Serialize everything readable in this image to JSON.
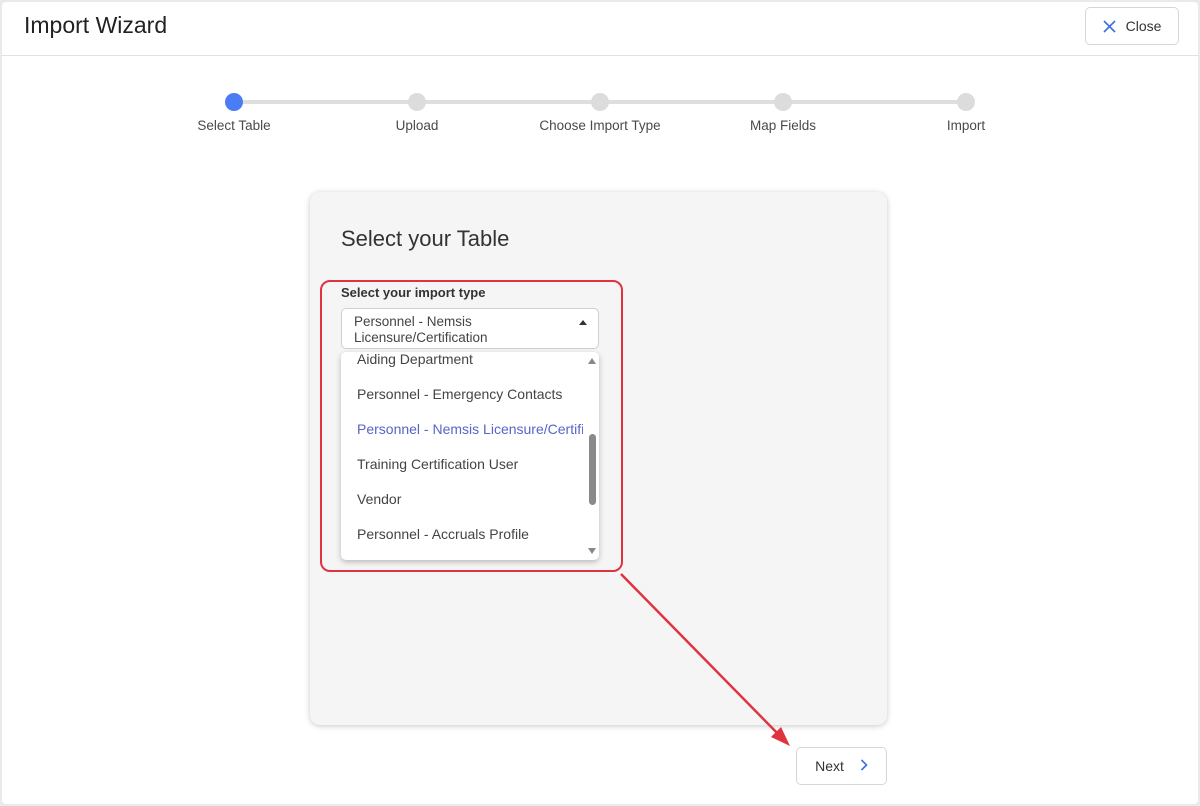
{
  "header": {
    "title": "Import Wizard",
    "close_label": "Close"
  },
  "stepper": {
    "steps": [
      {
        "label": "Select Table",
        "state": "active"
      },
      {
        "label": "Upload",
        "state": "pending"
      },
      {
        "label": "Choose Import Type",
        "state": "pending"
      },
      {
        "label": "Map Fields",
        "state": "pending"
      },
      {
        "label": "Import",
        "state": "pending"
      }
    ]
  },
  "card": {
    "title": "Select your Table",
    "select_label": "Select your import type",
    "selected_value": "Personnel - Nemsis Licensure/Certification",
    "options": [
      "Aiding Department",
      "Personnel - Emergency Contacts",
      "Personnel - Nemsis Licensure/Certification",
      "Training Certification User",
      "Vendor",
      "Personnel - Accruals Profile"
    ],
    "selected_index": 2
  },
  "footer": {
    "next_label": "Next"
  },
  "colors": {
    "accent": "#4a7df5",
    "selected_option": "#5a63c9",
    "annotation": "#e03340"
  },
  "icons": {
    "close": "close-x-icon",
    "next": "chevron-right-icon"
  }
}
